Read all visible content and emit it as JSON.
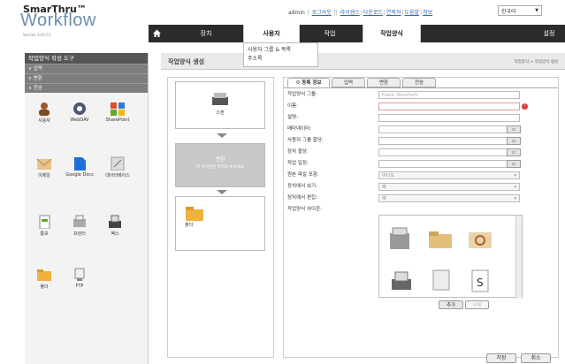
{
  "header": {
    "logo_top": "SmarThru™",
    "logo_main": "Workflow",
    "version": "Version 3.00.53",
    "user": "admin",
    "links": [
      "로그아웃",
      "라이센스",
      "다운로드",
      "연락처",
      "도움말",
      "정보"
    ],
    "language": "한국어"
  },
  "nav": {
    "items": [
      "장치",
      "사용자",
      "작업",
      "작업양식",
      "설정"
    ]
  },
  "submenu": {
    "items": [
      "사용자 그룹 & 목록",
      "주소록"
    ]
  },
  "sidebar": {
    "title": "작업양식 작성 도구",
    "sections": [
      "입력",
      "변환",
      "전송"
    ],
    "icons": [
      {
        "label": "사용자",
        "icon": "user-icon"
      },
      {
        "label": "WebDAV",
        "icon": "webdav-icon"
      },
      {
        "label": "SharePoint",
        "icon": "sharepoint-icon"
      },
      {
        "label": "이메일",
        "icon": "email-icon"
      },
      {
        "label": "Google Docs",
        "icon": "google-docs-icon"
      },
      {
        "label": "데이터베이스",
        "icon": "database-icon"
      },
      {
        "label": "통보",
        "icon": "notify-icon"
      },
      {
        "label": "프린터",
        "icon": "printer-icon"
      },
      {
        "label": "팩스",
        "icon": "fax-icon"
      },
      {
        "label": "폴더",
        "icon": "folder-icon"
      },
      {
        "label": "FTP",
        "icon": "ftp-icon"
      }
    ]
  },
  "content": {
    "title": "작업양식 생성",
    "breadcrumb": "작업양식 > 작업양식 생성",
    "flow": {
      "scan_label": "스캔",
      "transform_title": "변환",
      "transform_hint": "원 아이콘을 끌어다 놓으세요",
      "store_label": "폴더"
    },
    "tabs": [
      "등록 정보",
      "입력",
      "변환",
      "전송"
    ],
    "form": {
      "rows": [
        {
          "label": "작업양식 그룹:",
          "value": "Public Workform",
          "kind": "input"
        },
        {
          "label": "이름:",
          "value": "",
          "kind": "error"
        },
        {
          "label": "설명:",
          "value": "",
          "kind": "input"
        },
        {
          "label": "메타데이터:",
          "value": "",
          "kind": "button"
        },
        {
          "label": "사용자 그룹 할당:",
          "value": "",
          "kind": "button"
        },
        {
          "label": "장치 할당:",
          "value": "",
          "kind": "button"
        },
        {
          "label": "작업 일정:",
          "value": "",
          "kind": "button"
        },
        {
          "label": "원본 파일 포함:",
          "value": "아니오",
          "kind": "select"
        },
        {
          "label": "장치에서 보기:",
          "value": "예",
          "kind": "select"
        },
        {
          "label": "장치에서 편집:",
          "value": "예",
          "kind": "select"
        },
        {
          "label": "작업양식 아이콘:",
          "value": "",
          "kind": "none"
        }
      ],
      "add_label": "추가",
      "delete_label": "삭제"
    },
    "footer": {
      "save_label": "저장",
      "cancel_label": "취소"
    }
  }
}
